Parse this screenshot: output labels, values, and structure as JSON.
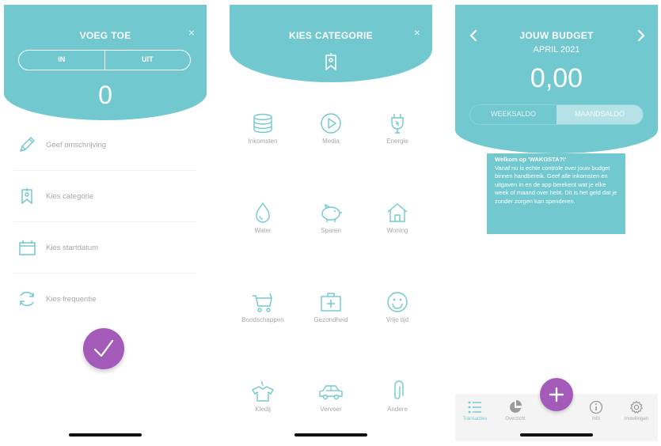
{
  "screen_add": {
    "title": "VOEG TOE",
    "close": "×",
    "segment": {
      "in": "IN",
      "out": "UIT"
    },
    "amount": "0",
    "fields": [
      {
        "icon": "pencil-icon",
        "label": "Geef omschrijving"
      },
      {
        "icon": "tag-icon",
        "label": "Kies categorie"
      },
      {
        "icon": "calendar-icon",
        "label": "Kies startdatum"
      },
      {
        "icon": "refresh-icon",
        "label": "Kies frequentie"
      }
    ],
    "confirm_icon": "checkmark-icon"
  },
  "screen_category": {
    "title": "KIES CATEGORIE",
    "close": "×",
    "categories": [
      {
        "icon": "coins-icon",
        "label": "Inkomsten"
      },
      {
        "icon": "play-icon",
        "label": "Media"
      },
      {
        "icon": "plug-icon",
        "label": "Energie"
      },
      {
        "icon": "drop-icon",
        "label": "Water"
      },
      {
        "icon": "piggybank-icon",
        "label": "Sparen"
      },
      {
        "icon": "house-icon",
        "label": "Woning"
      },
      {
        "icon": "cart-icon",
        "label": "Boodschappen"
      },
      {
        "icon": "firstaid-icon",
        "label": "Gezondheid"
      },
      {
        "icon": "smiley-icon",
        "label": "Vrije tijd"
      },
      {
        "icon": "shirt-icon",
        "label": "Kledij"
      },
      {
        "icon": "car-icon",
        "label": "Vervoer"
      },
      {
        "icon": "paperclip-icon",
        "label": "Andere"
      }
    ]
  },
  "screen_budget": {
    "title": "JOUW BUDGET",
    "month": "APRIL 2021",
    "amount": "0,00",
    "segment": {
      "week": "WEEKSALDO",
      "month": "MAANDSALDO",
      "active": "month"
    },
    "welcome": {
      "title": "Welkom op 'WAKOSTA?!'",
      "body": "Vanaf nu is echte controle over jouw budget binnen handbereik. Geef alle inkomsten en uitgaven in en de app berekent wat je elke week of maand over hebt. Dit is het geld dat je zonder zorgen kan spenderen."
    },
    "tabs": [
      {
        "icon": "list-icon",
        "label": "Transacties",
        "active": true
      },
      {
        "icon": "piechart-icon",
        "label": "Overzicht",
        "active": false
      },
      {
        "icon": "info-icon",
        "label": "Info",
        "active": false
      },
      {
        "icon": "gear-icon",
        "label": "Instellingen",
        "active": false
      }
    ]
  },
  "colors": {
    "accent": "#71c8cf",
    "fab": "#a35ab8",
    "muted_text": "#a8a8a8"
  }
}
